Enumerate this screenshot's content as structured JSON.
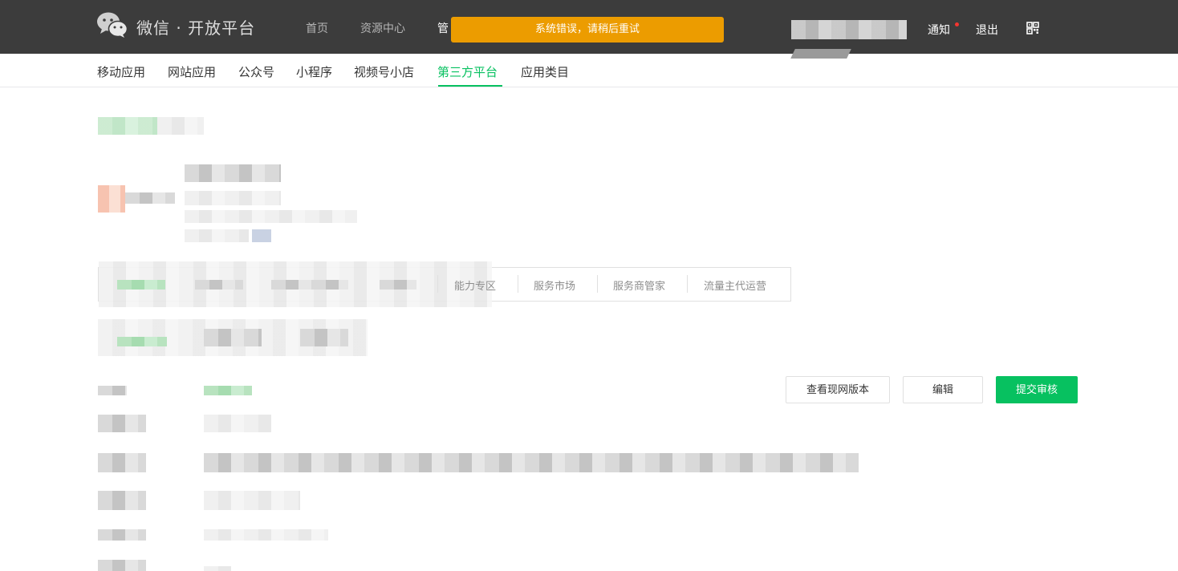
{
  "header": {
    "brand": "微信 · 开放平台",
    "nav": [
      {
        "label": "首页"
      },
      {
        "label": "资源中心"
      },
      {
        "label": "管"
      }
    ],
    "toast": "系统错误，请稍后重试",
    "notify_label": "通知",
    "logout_label": "退出",
    "icons": {
      "logo": "wechat-logo-icon",
      "qr": "qr-code-icon"
    },
    "colors": {
      "bar": "#3c3c3c",
      "toast": "#ec9c00",
      "dot": "#f43530"
    }
  },
  "subnav": {
    "items": [
      {
        "label": "移动应用"
      },
      {
        "label": "网站应用"
      },
      {
        "label": "公众号"
      },
      {
        "label": "小程序"
      },
      {
        "label": "视频号小店"
      },
      {
        "label": "第三方平台"
      },
      {
        "label": "应用类目"
      }
    ],
    "active": "第三方平台",
    "accent": "#07c160"
  },
  "tabs": {
    "visible": [
      {
        "label": "能力专区"
      },
      {
        "label": "服务市场"
      },
      {
        "label": "服务商管家"
      },
      {
        "label": "流量主代运营"
      }
    ]
  },
  "actions": {
    "view_live": "查看现网版本",
    "edit": "编辑",
    "submit": "提交审核"
  }
}
